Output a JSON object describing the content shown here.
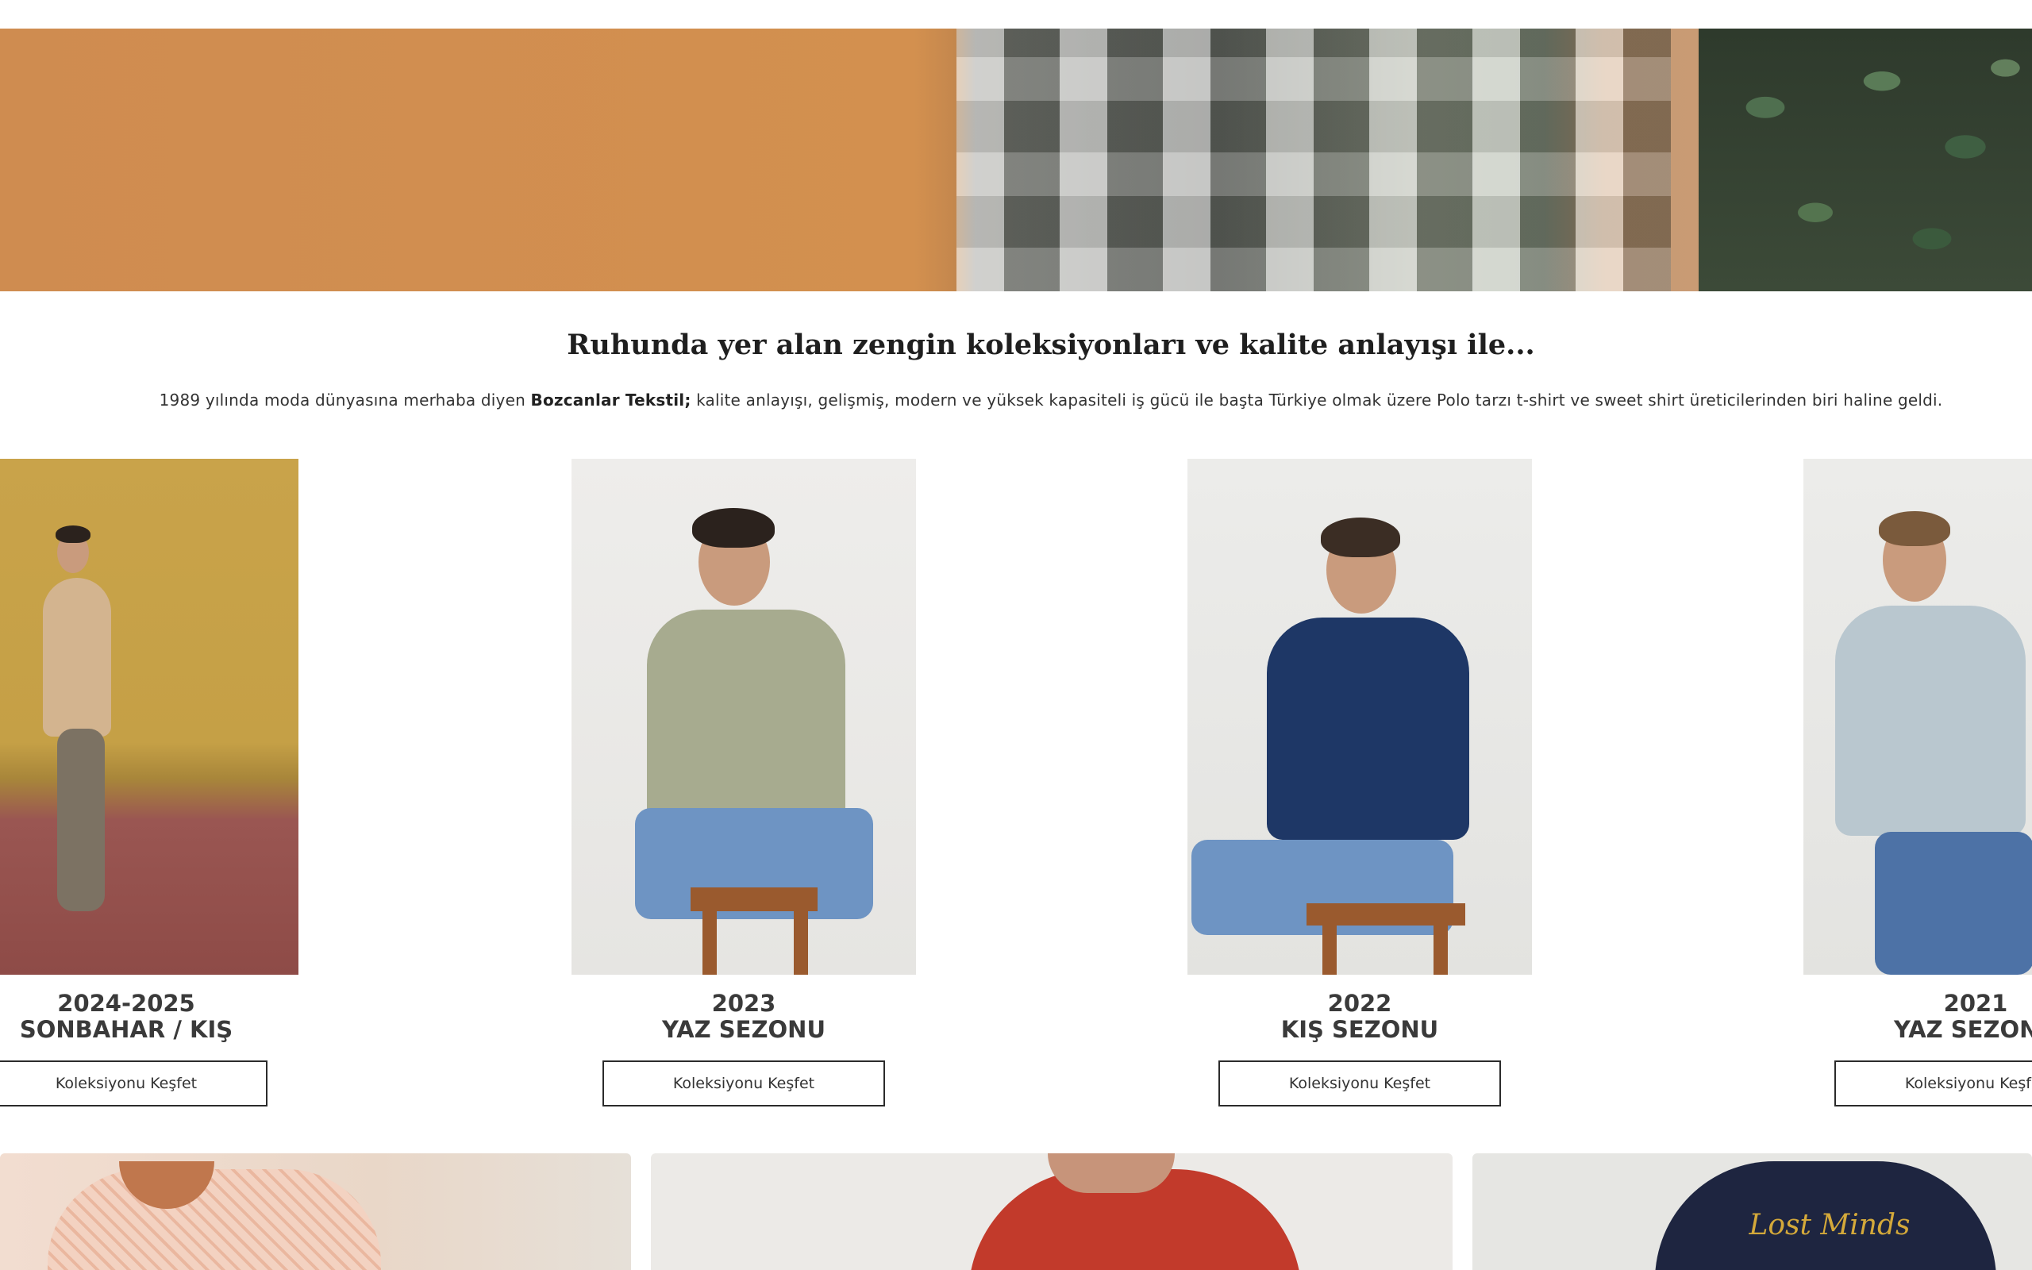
{
  "hero": {
    "image_description": ""
  },
  "intro": {
    "heading": "Ruhunda yer alan zengin koleksiyonları ve kalite anlayışı ile...",
    "text_before": "1989 yılında moda dünyasına merhaba diyen ",
    "brand": "Bozcanlar Tekstil;",
    "text_after": " kalite anlayışı, gelişmiş, modern ve yüksek kapasiteli iş gücü ile başta Türkiye olmak üzere Polo tarzı t-shirt ve sweet shirt üreticilerinden biri haline geldi."
  },
  "collections": [
    {
      "year": "2024-2025",
      "season": "SONBAHAR / KIŞ",
      "button": "Koleksiyonu Keşfet"
    },
    {
      "year": "2023",
      "season": "YAZ SEZONU",
      "button": "Koleksiyonu Keşfet"
    },
    {
      "year": "2022",
      "season": "KIŞ SEZONU",
      "button": "Koleksiyonu Keşfet"
    },
    {
      "year": "2021",
      "season": "YAZ SEZONU",
      "button": "Koleksiyonu Keşfet"
    }
  ],
  "bottom_tiles": [
    {
      "graphic_text": "Lost Minds"
    },
    {
      "graphic_text": ""
    },
    {
      "graphic_text": ""
    }
  ],
  "colors": {
    "hero_orange": "#cf8c50",
    "button_border": "#2b2b2b",
    "text_dark": "#1f1f1f"
  }
}
